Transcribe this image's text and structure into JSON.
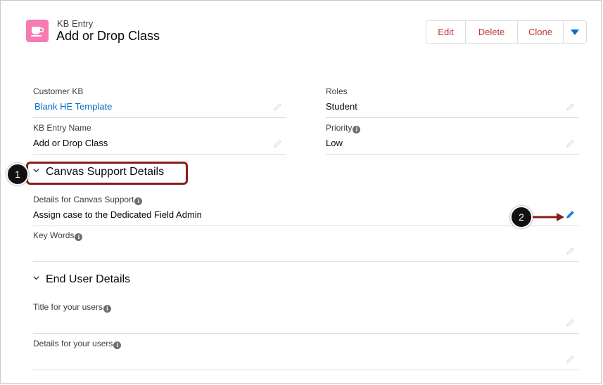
{
  "header": {
    "object_type": "KB Entry",
    "record_title": "Add or Drop Class",
    "buttons": {
      "edit": "Edit",
      "delete": "Delete",
      "clone": "Clone"
    }
  },
  "fields": {
    "customer_kb": {
      "label": "Customer KB",
      "value": "Blank HE Template"
    },
    "roles": {
      "label": "Roles",
      "value": "Student"
    },
    "kb_entry_name": {
      "label": "KB Entry Name",
      "value": "Add or Drop Class"
    },
    "priority": {
      "label": "Priority",
      "value": "Low"
    }
  },
  "sections": {
    "canvas_support": {
      "title": "Canvas Support Details",
      "details": {
        "label": "Details for Canvas Support",
        "value": "Assign case to the Dedicated Field Admin"
      },
      "key_words": {
        "label": "Key Words",
        "value": ""
      }
    },
    "end_user": {
      "title": "End User Details",
      "title_for_users": {
        "label": "Title for your users",
        "value": ""
      },
      "details_for_users": {
        "label": "Details for your users",
        "value": ""
      }
    }
  },
  "callouts": {
    "one": "1",
    "two": "2"
  },
  "colors": {
    "icon_bg": "#f57bb1",
    "button_text": "#c23934",
    "link": "#006dcc",
    "accent_blue": "#0070d2",
    "highlight_border": "#8b1a1a"
  }
}
